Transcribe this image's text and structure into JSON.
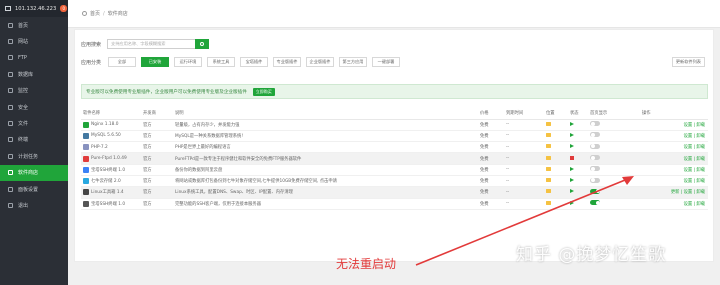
{
  "header": {
    "ip": "101.132.46.223",
    "notif_count": "0"
  },
  "sidebar": {
    "items": [
      {
        "label": "首页",
        "icon": "home-icon"
      },
      {
        "label": "网站",
        "icon": "globe-icon"
      },
      {
        "label": "FTP",
        "icon": "ftp-icon"
      },
      {
        "label": "数据库",
        "icon": "database-icon"
      },
      {
        "label": "监控",
        "icon": "monitor-icon"
      },
      {
        "label": "安全",
        "icon": "shield-icon"
      },
      {
        "label": "文件",
        "icon": "folder-icon"
      },
      {
        "label": "终端",
        "icon": "terminal-icon"
      },
      {
        "label": "计划任务",
        "icon": "clock-icon"
      },
      {
        "label": "软件商店",
        "icon": "store-icon",
        "active": true
      },
      {
        "label": "面板设置",
        "icon": "gear-icon"
      },
      {
        "label": "退出",
        "icon": "logout-icon"
      }
    ]
  },
  "breadcrumb": {
    "home": "首页",
    "current": "软件商店"
  },
  "search": {
    "label": "应用搜索",
    "placeholder": "支持应用名称、字段模糊搜索"
  },
  "categories": {
    "label": "应用分类",
    "items": [
      "全部",
      "已安装",
      "运行环境",
      "系统工具",
      "宝塔插件",
      "专业版插件",
      "企业版插件",
      "第三方应用",
      "一键部署"
    ],
    "selected": "已安装"
  },
  "refresh_label": "更新软件列表",
  "notice": {
    "text": "专业版可以免费使用专业版插件，企业版用户可以免费使用专业版及企业版插件",
    "buy": "立即购买"
  },
  "table": {
    "headers": [
      "软件名称",
      "开发商",
      "说明",
      "价格",
      "到期时间",
      "位置",
      "状态",
      "首页显示",
      "操作"
    ],
    "rows": [
      {
        "name": "Nginx 1.18.0",
        "dev": "官方",
        "desc": "轻量级，占有内存少，并发能力强",
        "price": "免费",
        "expire": "--",
        "status": "play",
        "home": false,
        "ops": "设置 | 卸载",
        "logo": "#20a53a"
      },
      {
        "name": "MySQL 5.6.50",
        "dev": "官方",
        "desc": "MySQL是一种关系数据库管理系统!",
        "price": "免费",
        "expire": "--",
        "status": "play",
        "home": false,
        "ops": "设置 | 卸载",
        "logo": "#4479a1"
      },
      {
        "name": "PHP-7.2",
        "dev": "官方",
        "desc": "PHP是世界上最好的编程语言",
        "price": "免费",
        "expire": "--",
        "status": "play",
        "home": false,
        "ops": "设置 | 卸载",
        "logo": "#8892bf"
      },
      {
        "name": "Pure-Ftpd 1.0.49",
        "dev": "官方",
        "desc": "PureFTPd是一款专注于程序健壮和软件安全的免费FTP服务器软件",
        "price": "免费",
        "expire": "--",
        "status": "stop",
        "home": false,
        "ops": "设置 | 卸载",
        "logo": "#e03c3c",
        "highlight": true
      },
      {
        "name": "宝塔SSH终端 1.0",
        "dev": "官方",
        "desc": "备份你的数据到阿里云盘",
        "price": "免费",
        "expire": "--",
        "status": "play",
        "home": false,
        "ops": "设置 | 卸载",
        "logo": "#3b82f6"
      },
      {
        "name": "七牛云存储 2.0",
        "dev": "官方",
        "desc": "将网站或数据库打包备份到七牛对象存储空间,七牛提供10GB免费存储空间, 点击申请",
        "price": "免费",
        "expire": "--",
        "status": "play",
        "home": false,
        "ops": "设置 | 卸载",
        "logo": "#28a8e0"
      },
      {
        "name": "Linux工具箱 1.4",
        "dev": "官方",
        "desc": "Linux系统工具，配置DNS、Swap、时区、IP配置、内存清理",
        "price": "免费",
        "expire": "--",
        "status": "play",
        "home": true,
        "ops": "更新 | 设置 | 卸载",
        "logo": "#444444",
        "highlight": true
      },
      {
        "name": "宝塔SSH终端 1.0",
        "dev": "官方",
        "desc": "完整功能的SSH客户端，仅用于连接本服务器",
        "price": "免费",
        "expire": "--",
        "status": "play",
        "home": true,
        "ops": "设置 | 卸载",
        "logo": "#555555"
      }
    ]
  },
  "annotation": "无法重启动",
  "watermark": "知乎 @挽梦忆笙歌",
  "colors": {
    "accent": "#20a53a",
    "sidebar": "#2b2f36",
    "danger": "#e23a3a"
  }
}
